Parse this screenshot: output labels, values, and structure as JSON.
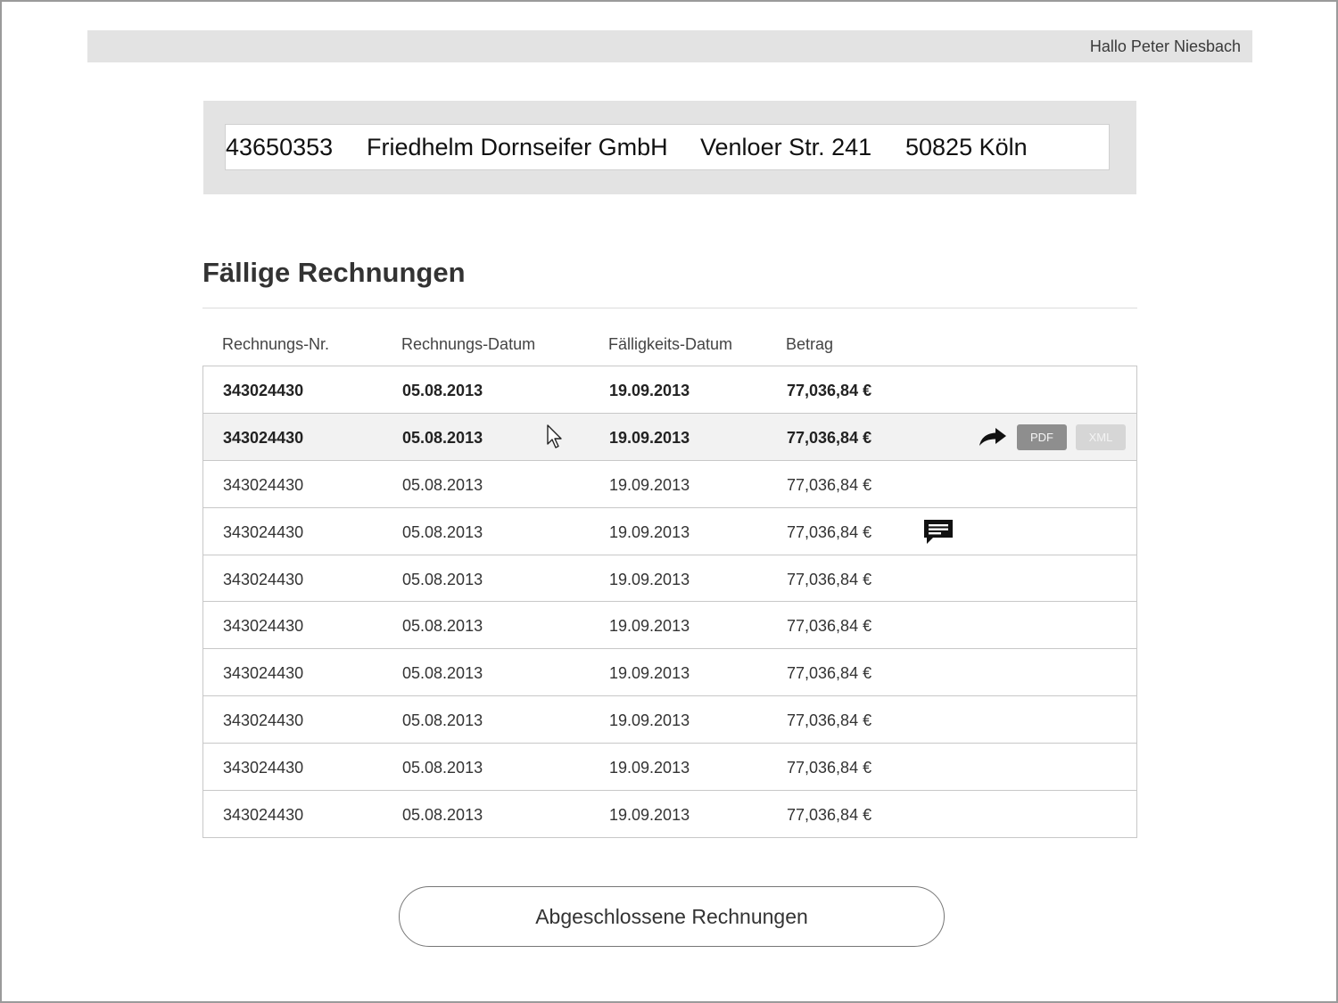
{
  "header": {
    "greeting": "Hallo Peter Niesbach"
  },
  "customer": {
    "number": "43650353",
    "name": "Friedhelm Dornseifer GmbH",
    "street": "Venloer Str. 241",
    "city": "50825 Köln"
  },
  "invoices": {
    "title": "Fällige Rechnungen",
    "columns": {
      "nr": "Rechnungs-Nr.",
      "datum": "Rechnungs-Datum",
      "faellig": "Fälligkeits-Datum",
      "betrag": "Betrag"
    },
    "rows": [
      {
        "nr": "343024430",
        "datum": "05.08.2013",
        "faellig": "19.09.2013",
        "betrag": "77,036,84 €"
      },
      {
        "nr": "343024430",
        "datum": "05.08.2013",
        "faellig": "19.09.2013",
        "betrag": "77,036,84 €"
      },
      {
        "nr": "343024430",
        "datum": "05.08.2013",
        "faellig": "19.09.2013",
        "betrag": "77,036,84 €"
      },
      {
        "nr": "343024430",
        "datum": "05.08.2013",
        "faellig": "19.09.2013",
        "betrag": "77,036,84 €"
      },
      {
        "nr": "343024430",
        "datum": "05.08.2013",
        "faellig": "19.09.2013",
        "betrag": "77,036,84 €"
      },
      {
        "nr": "343024430",
        "datum": "05.08.2013",
        "faellig": "19.09.2013",
        "betrag": "77,036,84 €"
      },
      {
        "nr": "343024430",
        "datum": "05.08.2013",
        "faellig": "19.09.2013",
        "betrag": "77,036,84 €"
      },
      {
        "nr": "343024430",
        "datum": "05.08.2013",
        "faellig": "19.09.2013",
        "betrag": "77,036,84 €"
      },
      {
        "nr": "343024430",
        "datum": "05.08.2013",
        "faellig": "19.09.2013",
        "betrag": "77,036,84 €"
      },
      {
        "nr": "343024430",
        "datum": "05.08.2013",
        "faellig": "19.09.2013",
        "betrag": "77,036,84 €"
      }
    ],
    "actions": {
      "pdf_label": "PDF",
      "xml_label": "XML",
      "forward_icon": "forward-arrow-icon",
      "comment_icon": "comment-icon"
    }
  },
  "footer": {
    "archive_button_label": "Abgeschlossene Rechnungen"
  }
}
